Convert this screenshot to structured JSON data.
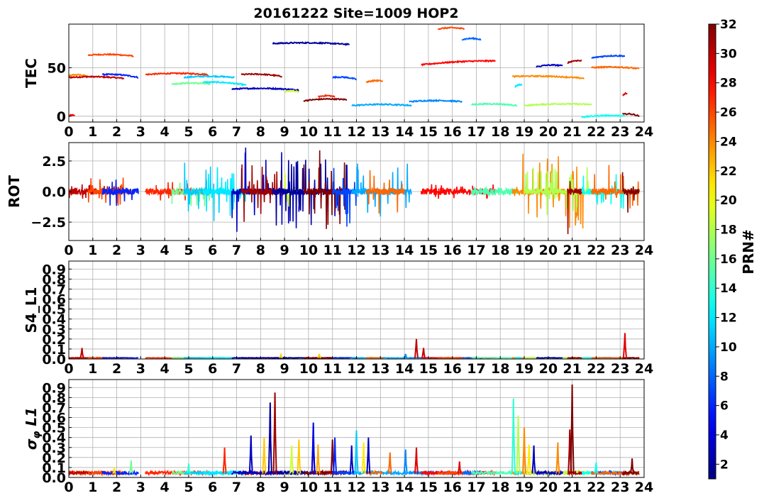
{
  "title": "20161222 Site=1009 HOP2",
  "colorbar": {
    "label": "PRN#",
    "range": [
      1,
      32
    ],
    "ticks": [
      "2",
      "4",
      "6",
      "8",
      "10",
      "12",
      "14",
      "16",
      "18",
      "20",
      "22",
      "24",
      "26",
      "28",
      "30",
      "32"
    ],
    "colormap": "jet"
  },
  "chart_data": [
    {
      "type": "line",
      "ylabel": "TEC",
      "xlim": [
        0,
        24
      ],
      "ylim": [
        -6,
        95
      ],
      "xticks": [
        "0",
        "1",
        "2",
        "3",
        "4",
        "5",
        "6",
        "7",
        "8",
        "9",
        "10",
        "11",
        "12",
        "13",
        "14",
        "15",
        "16",
        "17",
        "18",
        "19",
        "20",
        "21",
        "22",
        "23",
        "24"
      ],
      "yticks": [
        {
          "value": 0,
          "label": "0"
        },
        {
          "value": 50,
          "label": "50"
        }
      ],
      "grid": true,
      "series": [
        {
          "prn": 28,
          "x": [
            0.0,
            0.25
          ],
          "y": [
            0,
            0
          ]
        },
        {
          "prn": 24,
          "x": [
            0.0,
            0.8
          ],
          "y": [
            42,
            41
          ]
        },
        {
          "prn": 30,
          "x": [
            0.0,
            2.3
          ],
          "y": [
            40,
            39
          ]
        },
        {
          "prn": 26,
          "x": [
            0.8,
            2.7
          ],
          "y": [
            63,
            62
          ]
        },
        {
          "prn": 6,
          "x": [
            1.4,
            2.9
          ],
          "y": [
            43,
            40
          ]
        },
        {
          "prn": 27,
          "x": [
            3.2,
            5.8
          ],
          "y": [
            43,
            43
          ]
        },
        {
          "prn": 16,
          "x": [
            4.3,
            5.9
          ],
          "y": [
            33,
            33
          ]
        },
        {
          "prn": 11,
          "x": [
            4.8,
            6.9
          ],
          "y": [
            40,
            40
          ]
        },
        {
          "prn": 12,
          "x": [
            5.6,
            7.4
          ],
          "y": [
            35,
            32
          ]
        },
        {
          "prn": 31,
          "x": [
            7.2,
            8.9
          ],
          "y": [
            43,
            41
          ]
        },
        {
          "prn": 3,
          "x": [
            6.8,
            9.6
          ],
          "y": [
            28,
            27
          ]
        },
        {
          "prn": 19,
          "x": [
            9.0,
            9.6
          ],
          "y": [
            25,
            25
          ]
        },
        {
          "prn": 2,
          "x": [
            8.5,
            11.7
          ],
          "y": [
            75,
            74
          ]
        },
        {
          "prn": 27,
          "x": [
            10.4,
            11.1
          ],
          "y": [
            20,
            20
          ]
        },
        {
          "prn": 32,
          "x": [
            9.8,
            11.6
          ],
          "y": [
            16,
            17
          ]
        },
        {
          "prn": 7,
          "x": [
            11.0,
            12.0
          ],
          "y": [
            40,
            38
          ]
        },
        {
          "prn": 10,
          "x": [
            11.8,
            14.3
          ],
          "y": [
            11,
            11
          ]
        },
        {
          "prn": 25,
          "x": [
            12.4,
            13.1
          ],
          "y": [
            35,
            36
          ]
        },
        {
          "prn": 9,
          "x": [
            14.2,
            16.4
          ],
          "y": [
            15,
            15
          ]
        },
        {
          "prn": 28,
          "x": [
            14.7,
            17.8
          ],
          "y": [
            53,
            57
          ]
        },
        {
          "prn": 26,
          "x": [
            15.4,
            16.5
          ],
          "y": [
            90,
            90
          ]
        },
        {
          "prn": 8,
          "x": [
            16.4,
            17.2
          ],
          "y": [
            79,
            79
          ]
        },
        {
          "prn": 15,
          "x": [
            16.8,
            18.7
          ],
          "y": [
            12,
            11
          ]
        },
        {
          "prn": 24,
          "x": [
            18.5,
            21.5
          ],
          "y": [
            41,
            39
          ]
        },
        {
          "prn": 12,
          "x": [
            18.6,
            18.9
          ],
          "y": [
            30,
            32
          ]
        },
        {
          "prn": 18,
          "x": [
            19.0,
            21.8
          ],
          "y": [
            11,
            12
          ]
        },
        {
          "prn": 3,
          "x": [
            19.5,
            20.6
          ],
          "y": [
            51,
            52
          ]
        },
        {
          "prn": 31,
          "x": [
            20.8,
            21.4
          ],
          "y": [
            55,
            57
          ]
        },
        {
          "prn": 13,
          "x": [
            21.4,
            23.2
          ],
          "y": [
            -1,
            0
          ]
        },
        {
          "prn": 7,
          "x": [
            21.8,
            23.2
          ],
          "y": [
            60,
            62
          ]
        },
        {
          "prn": 25,
          "x": [
            21.8,
            23.8
          ],
          "y": [
            50,
            49
          ]
        },
        {
          "prn": 29,
          "x": [
            23.1,
            23.3
          ],
          "y": [
            21,
            23
          ]
        },
        {
          "prn": 32,
          "x": [
            23.1,
            23.8
          ],
          "y": [
            2,
            0
          ]
        }
      ]
    },
    {
      "type": "line",
      "ylabel": "ROT",
      "xlim": [
        0,
        24
      ],
      "ylim": [
        -4.0,
        4.0
      ],
      "xticks": [
        "0",
        "1",
        "2",
        "3",
        "4",
        "5",
        "6",
        "7",
        "8",
        "9",
        "10",
        "11",
        "12",
        "13",
        "14",
        "15",
        "16",
        "17",
        "18",
        "19",
        "20",
        "21",
        "22",
        "23",
        "24"
      ],
      "yticks": [
        {
          "value": 2.5,
          "label": "2.5"
        },
        {
          "value": 0,
          "label": "0.0"
        },
        {
          "value": -2.5,
          "label": "−2.5"
        }
      ],
      "grid": true,
      "activity": [
        {
          "prn": 30,
          "from": 0.0,
          "to": 2.3,
          "amp": 0.6
        },
        {
          "prn": 26,
          "from": 0.8,
          "to": 2.7,
          "amp": 1.2
        },
        {
          "prn": 6,
          "from": 1.4,
          "to": 2.9,
          "amp": 1.2
        },
        {
          "prn": 27,
          "from": 3.2,
          "to": 5.8,
          "amp": 0.8
        },
        {
          "prn": 16,
          "from": 4.3,
          "to": 5.9,
          "amp": 1.2
        },
        {
          "prn": 11,
          "from": 4.8,
          "to": 6.9,
          "amp": 2.5
        },
        {
          "prn": 12,
          "from": 5.6,
          "to": 7.4,
          "amp": 2.0
        },
        {
          "prn": 3,
          "from": 6.8,
          "to": 9.6,
          "amp": 3.6
        },
        {
          "prn": 31,
          "from": 7.2,
          "to": 8.9,
          "amp": 2.5
        },
        {
          "prn": 19,
          "from": 9.0,
          "to": 9.6,
          "amp": 2.0
        },
        {
          "prn": 2,
          "from": 8.5,
          "to": 11.7,
          "amp": 2.8
        },
        {
          "prn": 32,
          "from": 9.8,
          "to": 11.6,
          "amp": 3.6
        },
        {
          "prn": 7,
          "from": 11.0,
          "to": 12.0,
          "amp": 3.0
        },
        {
          "prn": 10,
          "from": 11.8,
          "to": 14.3,
          "amp": 2.5
        },
        {
          "prn": 25,
          "from": 12.4,
          "to": 14.0,
          "amp": 2.0
        },
        {
          "prn": 28,
          "from": 14.7,
          "to": 17.8,
          "amp": 0.6
        },
        {
          "prn": 15,
          "from": 16.8,
          "to": 18.7,
          "amp": 0.4
        },
        {
          "prn": 24,
          "from": 18.5,
          "to": 21.5,
          "amp": 3.6
        },
        {
          "prn": 18,
          "from": 19.0,
          "to": 21.8,
          "amp": 2.0
        },
        {
          "prn": 31,
          "from": 20.8,
          "to": 21.4,
          "amp": 3.9
        },
        {
          "prn": 13,
          "from": 21.4,
          "to": 23.2,
          "amp": 1.5
        },
        {
          "prn": 25,
          "from": 21.8,
          "to": 23.8,
          "amp": 2.2
        },
        {
          "prn": 32,
          "from": 23.1,
          "to": 23.8,
          "amp": 1.8
        }
      ]
    },
    {
      "type": "line",
      "ylabel": "S4_L1",
      "xlim": [
        0,
        24
      ],
      "ylim": [
        0,
        0.98
      ],
      "xticks": [
        "0",
        "1",
        "2",
        "3",
        "4",
        "5",
        "6",
        "7",
        "8",
        "9",
        "10",
        "11",
        "12",
        "13",
        "14",
        "15",
        "16",
        "17",
        "18",
        "19",
        "20",
        "21",
        "22",
        "23",
        "24"
      ],
      "yticks": [
        {
          "value": 0.0,
          "label": "0.0"
        },
        {
          "value": 0.1,
          "label": "0.1"
        },
        {
          "value": 0.2,
          "label": "0.2"
        },
        {
          "value": 0.3,
          "label": "0.3"
        },
        {
          "value": 0.4,
          "label": "0.4"
        },
        {
          "value": 0.5,
          "label": "0.5"
        },
        {
          "value": 0.6,
          "label": "0.6"
        },
        {
          "value": 0.7,
          "label": "0.7"
        },
        {
          "value": 0.8,
          "label": "0.8"
        },
        {
          "value": 0.9,
          "label": "0.9"
        }
      ],
      "grid": true,
      "baseline": 0.01,
      "spikes": [
        {
          "prn": 30,
          "x": 0.55,
          "y": 0.11
        },
        {
          "prn": 22,
          "x": 8.85,
          "y": 0.04
        },
        {
          "prn": 22,
          "x": 10.45,
          "y": 0.05
        },
        {
          "prn": 9,
          "x": 14.05,
          "y": 0.05
        },
        {
          "prn": 30,
          "x": 14.5,
          "y": 0.2
        },
        {
          "prn": 30,
          "x": 14.8,
          "y": 0.11
        },
        {
          "prn": 29,
          "x": 23.2,
          "y": 0.26
        }
      ]
    },
    {
      "type": "line",
      "ylabel": "σ_φ L1",
      "xlim": [
        0,
        24
      ],
      "ylim": [
        0,
        0.98
      ],
      "xticks": [
        "0",
        "1",
        "2",
        "3",
        "4",
        "5",
        "6",
        "7",
        "8",
        "9",
        "10",
        "11",
        "12",
        "13",
        "14",
        "15",
        "16",
        "17",
        "18",
        "19",
        "20",
        "21",
        "22",
        "23",
        "24"
      ],
      "yticks": [
        {
          "value": 0.0,
          "label": "0.0"
        },
        {
          "value": 0.1,
          "label": "0.1"
        },
        {
          "value": 0.2,
          "label": "0.2"
        },
        {
          "value": 0.3,
          "label": "0.3"
        },
        {
          "value": 0.4,
          "label": "0.4"
        },
        {
          "value": 0.5,
          "label": "0.5"
        },
        {
          "value": 0.6,
          "label": "0.6"
        },
        {
          "value": 0.7,
          "label": "0.7"
        },
        {
          "value": 0.8,
          "label": "0.8"
        },
        {
          "value": 0.9,
          "label": "0.9"
        }
      ],
      "grid": true,
      "baseline": 0.04,
      "spikes": [
        {
          "prn": 21,
          "x": 1.9,
          "y": 0.1
        },
        {
          "prn": 16,
          "x": 2.6,
          "y": 0.17
        },
        {
          "prn": 14,
          "x": 5.0,
          "y": 0.14
        },
        {
          "prn": 27,
          "x": 6.5,
          "y": 0.3
        },
        {
          "prn": 3,
          "x": 7.6,
          "y": 0.42
        },
        {
          "prn": 2,
          "x": 8.4,
          "y": 0.75
        },
        {
          "prn": 31,
          "x": 8.6,
          "y": 0.85
        },
        {
          "prn": 22,
          "x": 8.15,
          "y": 0.4
        },
        {
          "prn": 19,
          "x": 9.3,
          "y": 0.32
        },
        {
          "prn": 22,
          "x": 9.6,
          "y": 0.38
        },
        {
          "prn": 32,
          "x": 10.2,
          "y": 0.46
        },
        {
          "prn": 23,
          "x": 10.4,
          "y": 0.33
        },
        {
          "prn": 4,
          "x": 10.2,
          "y": 0.55
        },
        {
          "prn": 32,
          "x": 11.0,
          "y": 0.38
        },
        {
          "prn": 6,
          "x": 11.1,
          "y": 0.4
        },
        {
          "prn": 3,
          "x": 11.8,
          "y": 0.32
        },
        {
          "prn": 11,
          "x": 12.0,
          "y": 0.47
        },
        {
          "prn": 21,
          "x": 12.3,
          "y": 0.35
        },
        {
          "prn": 3,
          "x": 12.5,
          "y": 0.4
        },
        {
          "prn": 25,
          "x": 13.4,
          "y": 0.25
        },
        {
          "prn": 9,
          "x": 14.05,
          "y": 0.28
        },
        {
          "prn": 29,
          "x": 14.5,
          "y": 0.3
        },
        {
          "prn": 29,
          "x": 16.3,
          "y": 0.16
        },
        {
          "prn": 14,
          "x": 18.55,
          "y": 0.79
        },
        {
          "prn": 18,
          "x": 18.75,
          "y": 0.62
        },
        {
          "prn": 24,
          "x": 19.0,
          "y": 0.5
        },
        {
          "prn": 21,
          "x": 19.2,
          "y": 0.33
        },
        {
          "prn": 3,
          "x": 19.4,
          "y": 0.32
        },
        {
          "prn": 31,
          "x": 20.9,
          "y": 0.48
        },
        {
          "prn": 32,
          "x": 21.0,
          "y": 0.93
        },
        {
          "prn": 24,
          "x": 20.4,
          "y": 0.35
        },
        {
          "prn": 13,
          "x": 22.0,
          "y": 0.15
        },
        {
          "prn": 32,
          "x": 23.5,
          "y": 0.19
        }
      ]
    }
  ]
}
